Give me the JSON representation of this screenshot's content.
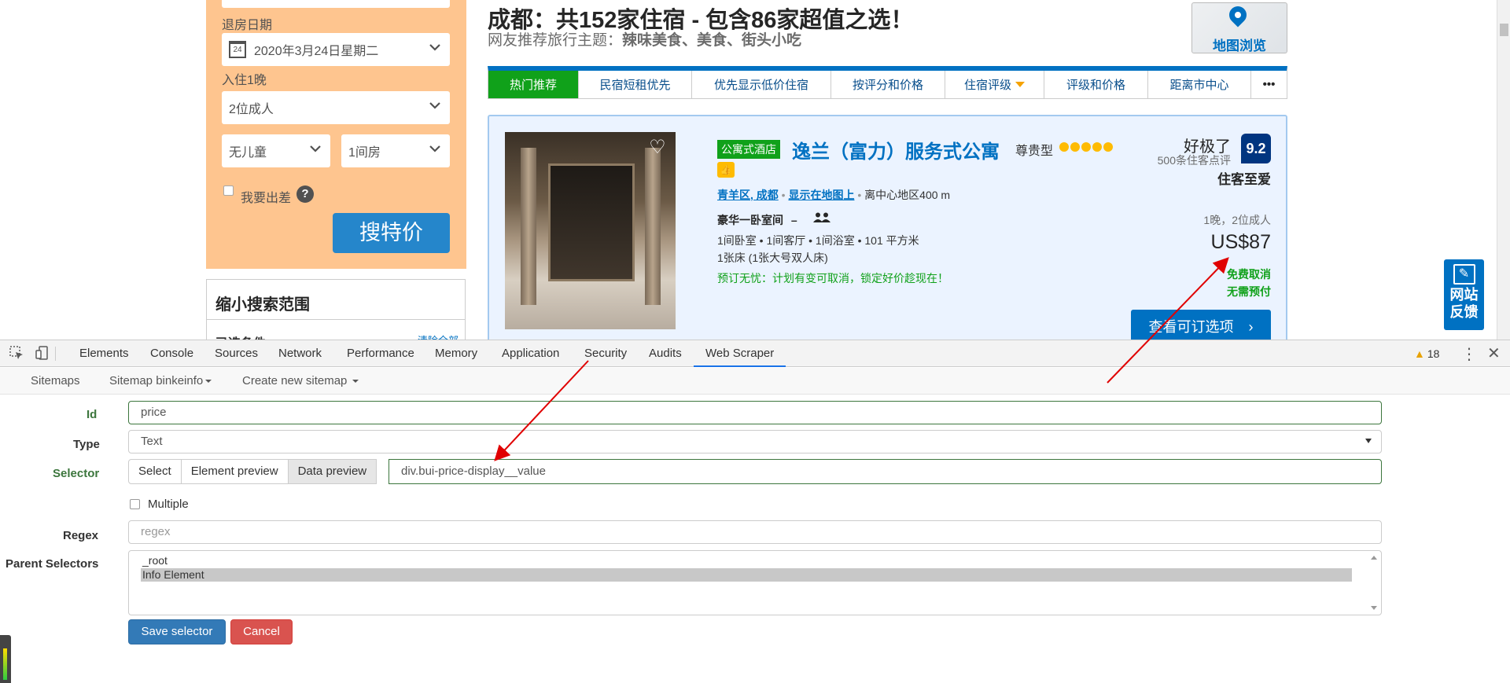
{
  "sidebar": {
    "checkout_label": "退房日期",
    "checkout_date": "2020年3月24日星期二",
    "calendar_day": "24",
    "nights_label": "入住1晚",
    "adults": "2位成人",
    "children": "无儿童",
    "rooms": "1间房",
    "business_trip_label": "我要出差",
    "help_glyph": "?",
    "search_button": "搜特价"
  },
  "filters": {
    "title": "缩小搜索范围",
    "subtitle": "已选条件",
    "clear_all": "清除全部"
  },
  "results": {
    "headline": "成都：共152家住宿 - 包含86家超值之选！",
    "theme_prefix": "网友推荐旅行主题：",
    "theme_tags": "辣味美食、美食、街头小吃",
    "map_button": "地图浏览"
  },
  "sort_tabs": [
    {
      "label": "热门推荐"
    },
    {
      "label": "民宿短租优先"
    },
    {
      "label": "优先显示低价住宿"
    },
    {
      "label": "按评分和价格"
    },
    {
      "label": "住宿评级"
    },
    {
      "label": "评级和价格"
    },
    {
      "label": "距离市中心"
    },
    {
      "label": "•••"
    }
  ],
  "hotel": {
    "type_badge": "公寓式酒店",
    "name": "逸兰（富力）服务式公寓",
    "tier": "尊贵型",
    "star_count": 5,
    "district_link": "青羊区, 成都",
    "map_link": "显示在地图上",
    "distance": "离中心地区400 m",
    "room_title": "豪华一卧室间",
    "room_separator": "–",
    "room_detail": "1间卧室 • 1间客厅 • 1间浴室 • 101 平方米",
    "room_bed": "1张床 (1张大号双人床)",
    "policy": "预订无忧：计划有变可取消，锁定好价趁现在！",
    "score_word": "好极了",
    "review_count": "500条住客点评",
    "score": "9.2",
    "score_tag": "住客至爱",
    "price_meta": "1晚，2位成人",
    "price": "US$87",
    "free_cancel": "免费取消",
    "no_prepay": "无需预付",
    "view_button": "查看可订选项"
  },
  "feedback": {
    "line1": "网站",
    "line2": "反馈"
  },
  "devtools": {
    "tabs": [
      "Elements",
      "Console",
      "Sources",
      "Network",
      "Performance",
      "Memory",
      "Application",
      "Security",
      "Audits",
      "Web Scraper"
    ],
    "active_tab": "Web Scraper",
    "warning_count": "18"
  },
  "scraper": {
    "nav": {
      "sitemaps": "Sitemaps",
      "sitemap_current": "Sitemap binkeinfo",
      "create_new": "Create new sitemap"
    },
    "labels": {
      "id": "Id",
      "type": "Type",
      "selector": "Selector",
      "multiple": "Multiple",
      "regex": "Regex",
      "parent_selectors": "Parent Selectors"
    },
    "id_value": "price",
    "type_value": "Text",
    "selector_buttons": [
      "Select",
      "Element preview",
      "Data preview"
    ],
    "selector_value": "div.bui-price-display__value",
    "regex_placeholder": "regex",
    "parent_options": [
      "_root",
      "Info Element"
    ],
    "parent_selected": "Info Element",
    "save_button": "Save selector",
    "cancel_button": "Cancel"
  },
  "colors": {
    "brand_blue": "#0071c2",
    "green": "#10a11a",
    "annotation_red": "#e00000"
  }
}
